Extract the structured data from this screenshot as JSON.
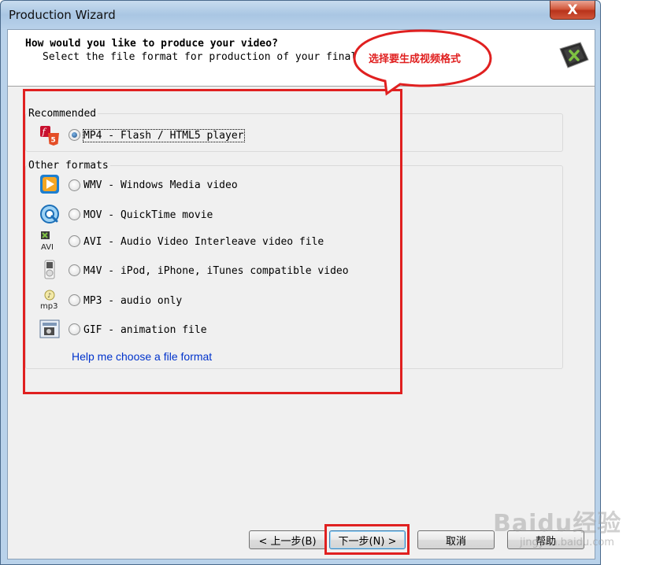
{
  "window": {
    "title": "Production Wizard",
    "close_label": "X"
  },
  "header": {
    "title": "How would you like to produce your video?",
    "subtitle": "Select the file format for production of your final video"
  },
  "annotation": {
    "text": "选择要生成视频格式"
  },
  "recommended": {
    "label": "Recommended",
    "options": [
      {
        "label": "MP4 - Flash / HTML5 player",
        "icon": "html5-flash-icon",
        "checked": true
      }
    ]
  },
  "other": {
    "label": "Other formats",
    "options": [
      {
        "label": "WMV - Windows Media video",
        "icon": "windows-media-icon",
        "checked": false
      },
      {
        "label": "MOV - QuickTime movie",
        "icon": "quicktime-icon",
        "checked": false
      },
      {
        "label": "AVI - Audio Video Interleave video file",
        "icon": "avi-icon",
        "checked": false
      },
      {
        "label": "M4V - iPod, iPhone, iTunes compatible video",
        "icon": "ipod-icon",
        "checked": false
      },
      {
        "label": "MP3 - audio only",
        "icon": "mp3-icon",
        "checked": false
      },
      {
        "label": "GIF - animation file",
        "icon": "gif-icon",
        "checked": false
      }
    ]
  },
  "help_link": "Help me choose a file format",
  "buttons": {
    "back": "< 上一步(B)",
    "next": "下一步(N) >",
    "cancel": "取消",
    "help": "帮助"
  },
  "watermark": {
    "main": "Baidu经验",
    "sub": "jingyan.baidu.com"
  },
  "colors": {
    "annotation": "#e02020",
    "link": "#0033cc"
  }
}
